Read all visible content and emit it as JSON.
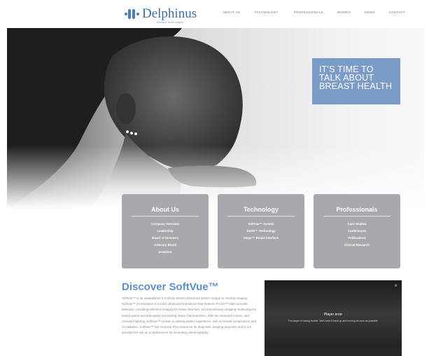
{
  "header": {
    "logo_text": "Delphinus",
    "logo_sub": "Medical Technologies",
    "nav": [
      "ABOUT US",
      "TECHNOLOGY",
      "PROFESSIONALS",
      "WOMEN",
      "NEWS",
      "CONTACT"
    ]
  },
  "hero": {
    "callout": "IT'S TIME TO TALK ABOUT BREAST HEALTH"
  },
  "cards": [
    {
      "title": "About Us",
      "links": [
        "Company Overview",
        "Leadership",
        "Board of Directors",
        "Advisory Board",
        "Investors"
      ]
    },
    {
      "title": "Technology",
      "links": [
        "SoftVue™ System",
        "SSAD™ Technology",
        "Sequr™ Breast Interface"
      ]
    },
    {
      "title": "Professionals",
      "links": [
        "Case Studies",
        "Conferences",
        "Publications",
        "Clinical Research"
      ]
    }
  ],
  "discover": {
    "title": "Discover SoftVue™",
    "text": "SoftVue™ is an unparalleled 3-D whole breast ultrasound system unique to medical imaging. SoftVue™ incorporates a circular ultrasound transducer that features ProVis™ triple acoustic detection, providing reflection imaging for tissue structure, and transmission imaging measuring the sound speed and attenuation presenting tissue characteristics. With its contoured curves, and recessed lighting, SoftVue™ evokes a calming patient experience, with no breast compression and no radiation. SoftVue™ has received FDA clearance for diagnostic imaging purposes and is not intended for use as a replacement for screening mammography."
  },
  "video": {
    "error_title": "Player error",
    "error_message": "The player is having trouble. We'll have it back up and running as soon as possible.",
    "close_glyph": "×"
  },
  "colors": {
    "brand_blue": "#5b8fca",
    "callout_bg": "#7b9cc9",
    "card_bg": "#a9a9ad"
  }
}
